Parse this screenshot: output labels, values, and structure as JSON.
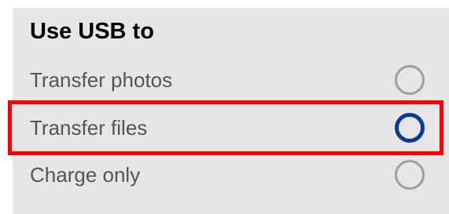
{
  "dialog": {
    "title": "Use USB to",
    "options": [
      {
        "label": "Transfer photos",
        "selected": false
      },
      {
        "label": "Transfer files",
        "selected": true
      },
      {
        "label": "Charge only",
        "selected": false
      }
    ]
  },
  "colors": {
    "panel_bg": "#e6e6e6",
    "radio_unselected": "#9e9e9e",
    "radio_selected": "#0a3a94",
    "highlight": "#ff0000"
  }
}
